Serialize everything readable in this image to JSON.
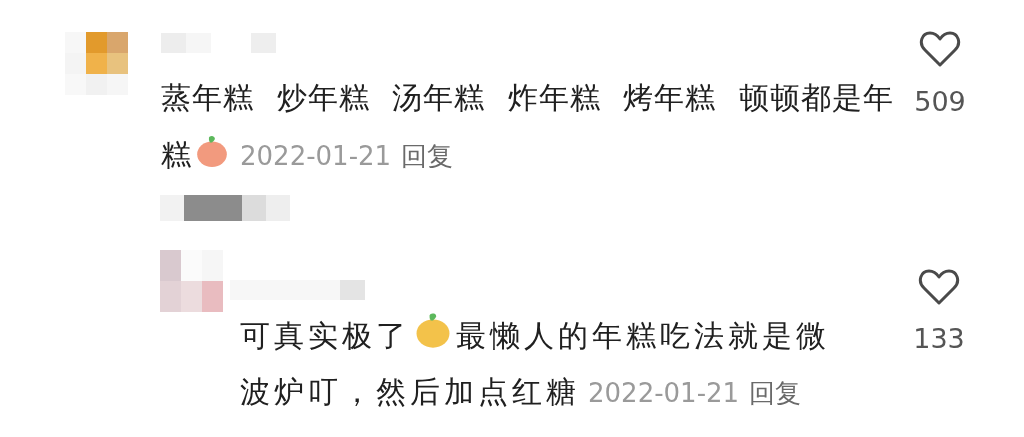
{
  "comments": [
    {
      "parts": [
        {
          "kind": "text",
          "text": "蒸年糕 炒年糕 汤年糕 炸年糕 烤年糕 顿顿都是年糕"
        },
        {
          "kind": "emoji",
          "color": "#f29a7e"
        }
      ],
      "date": "2022-01-21",
      "reply": "回复",
      "likes": "509",
      "replies": [
        {
          "parts": [
            {
              "kind": "text",
              "text": "可真实极了"
            },
            {
              "kind": "emoji",
              "color": "#f3c24a"
            },
            {
              "kind": "text",
              "text": "最懒人的年糕吃法就是微波炉叮，然后加点红糖"
            }
          ],
          "date": "2022-01-21",
          "reply": "回复",
          "likes": "133"
        }
      ]
    }
  ]
}
